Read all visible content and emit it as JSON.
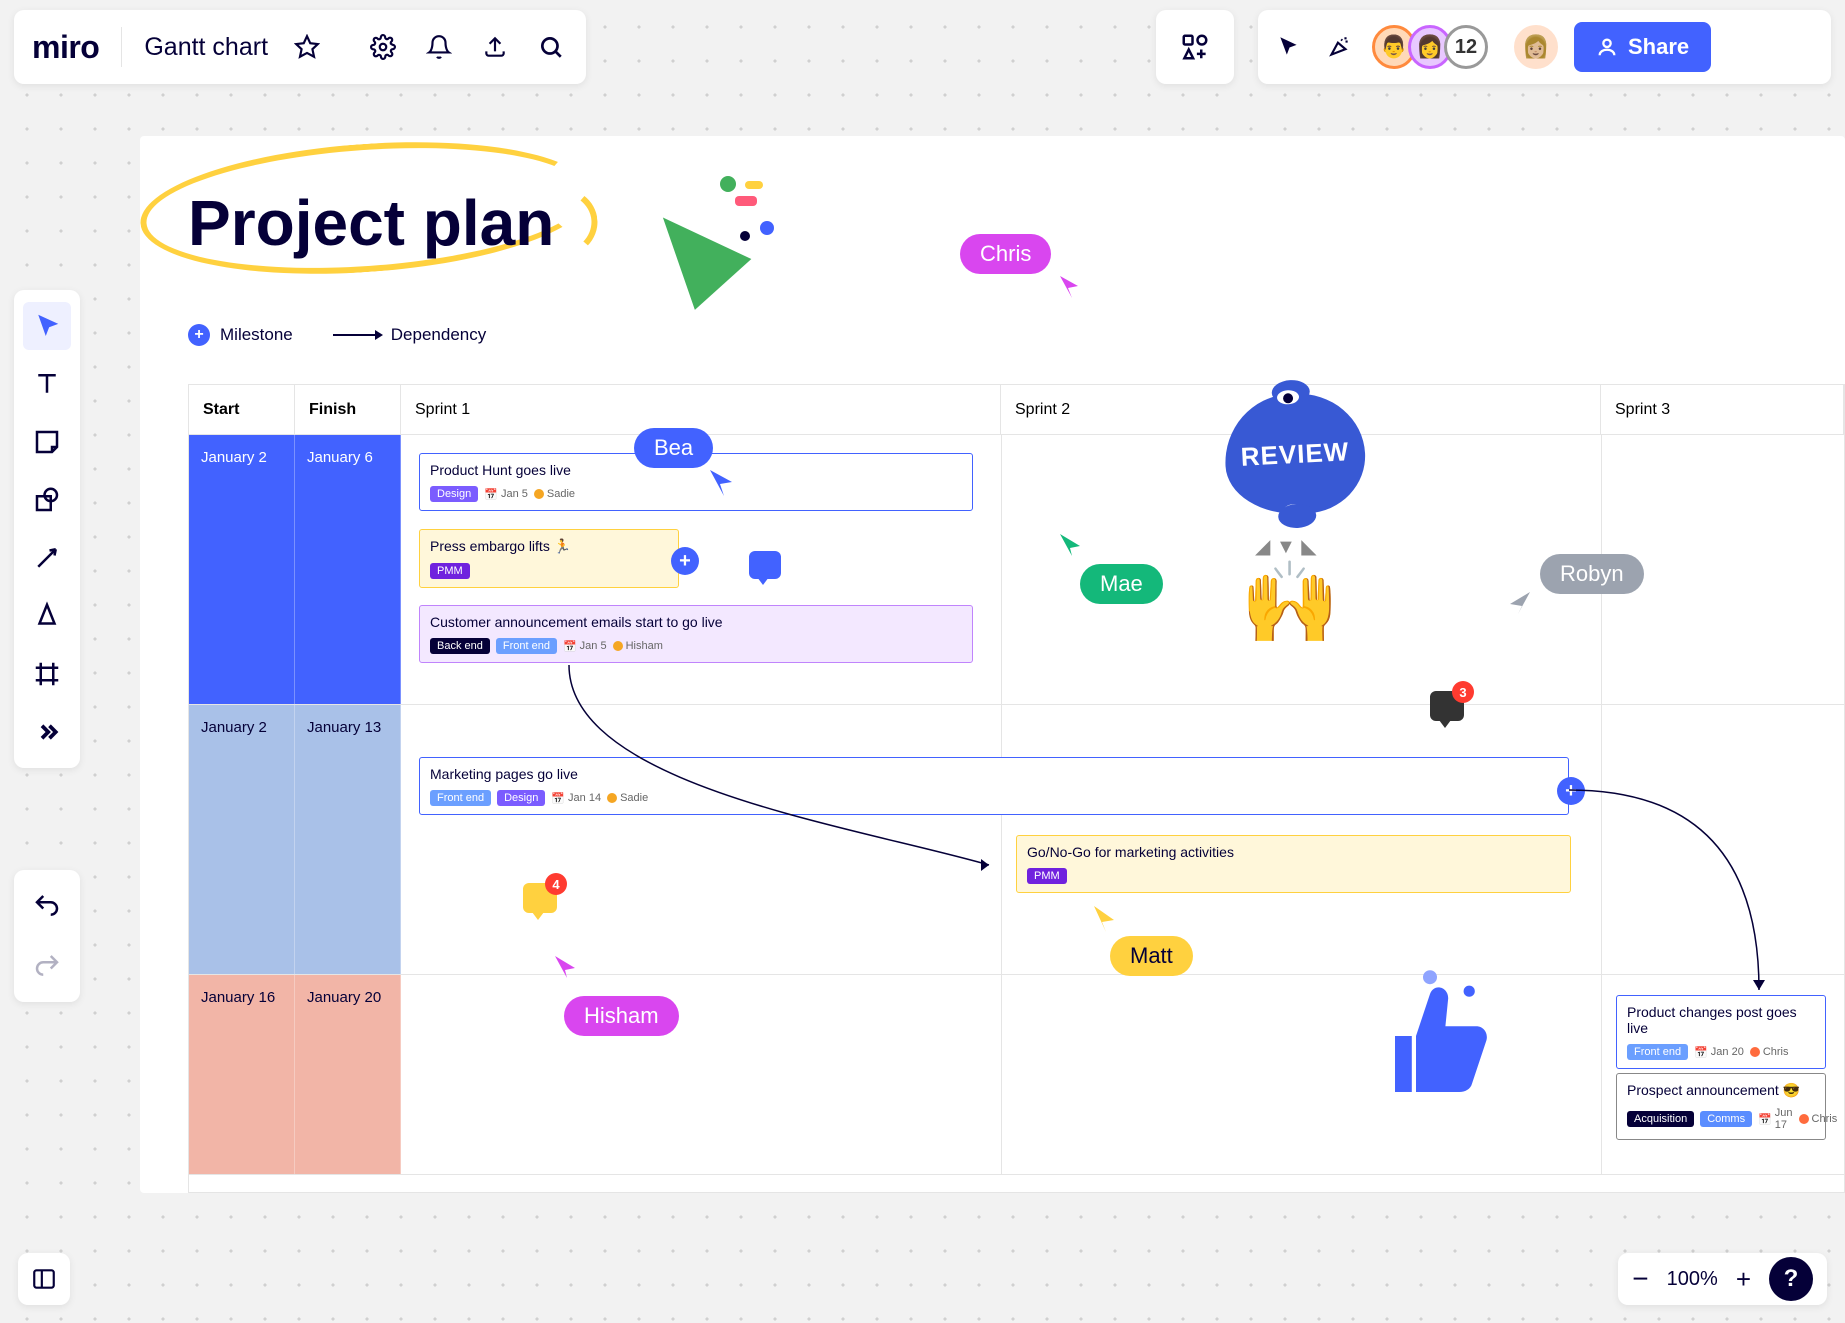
{
  "brand": "miro",
  "board_name": "Gantt chart",
  "top_right": {
    "overflow_count": "12",
    "share_label": "Share"
  },
  "canvas": {
    "title": "Project plan",
    "legend": {
      "milestone": "Milestone",
      "dependency": "Dependency"
    },
    "sticker_review": "REVIEW"
  },
  "gantt": {
    "headers": {
      "start": "Start",
      "finish": "Finish",
      "sprint1": "Sprint 1",
      "sprint2": "Sprint 2",
      "sprint3": "Sprint 3"
    },
    "rows": [
      {
        "start": "January 2",
        "finish": "January 6"
      },
      {
        "start": "January 2",
        "finish": "January 13"
      },
      {
        "start": "January 16",
        "finish": "January 20"
      }
    ]
  },
  "tasks": {
    "t1": {
      "title": "Product Hunt goes live",
      "tag1": "Design",
      "date": "Jan 5",
      "person": "Sadie"
    },
    "t2": {
      "title": "Press embargo lifts 🏃",
      "tag1": "PMM"
    },
    "t3": {
      "title": "Customer announcement emails start to go live",
      "tag1": "Back end",
      "tag2": "Front end",
      "date": "Jan 5",
      "person": "Hisham"
    },
    "t4": {
      "title": "Marketing pages go live",
      "tag1": "Front end",
      "tag2": "Design",
      "date": "Jan 14",
      "person": "Sadie"
    },
    "t5": {
      "title": "Go/No-Go for marketing activities",
      "tag1": "PMM"
    },
    "t6": {
      "title": "Product changes post goes live",
      "tag1": "Front end",
      "date": "Jan 20",
      "person": "Chris"
    },
    "t7": {
      "title": "Prospect announcement 😎",
      "tag1": "Acquisition",
      "tag2": "Comms",
      "date": "Jun 17",
      "person": "Chris"
    }
  },
  "cursors": {
    "chris": "Chris",
    "bea": "Bea",
    "mae": "Mae",
    "robyn": "Robyn",
    "matt": "Matt",
    "hisham": "Hisham"
  },
  "chat": {
    "c1": "4",
    "c2": "3"
  },
  "zoom": {
    "pct": "100%"
  }
}
